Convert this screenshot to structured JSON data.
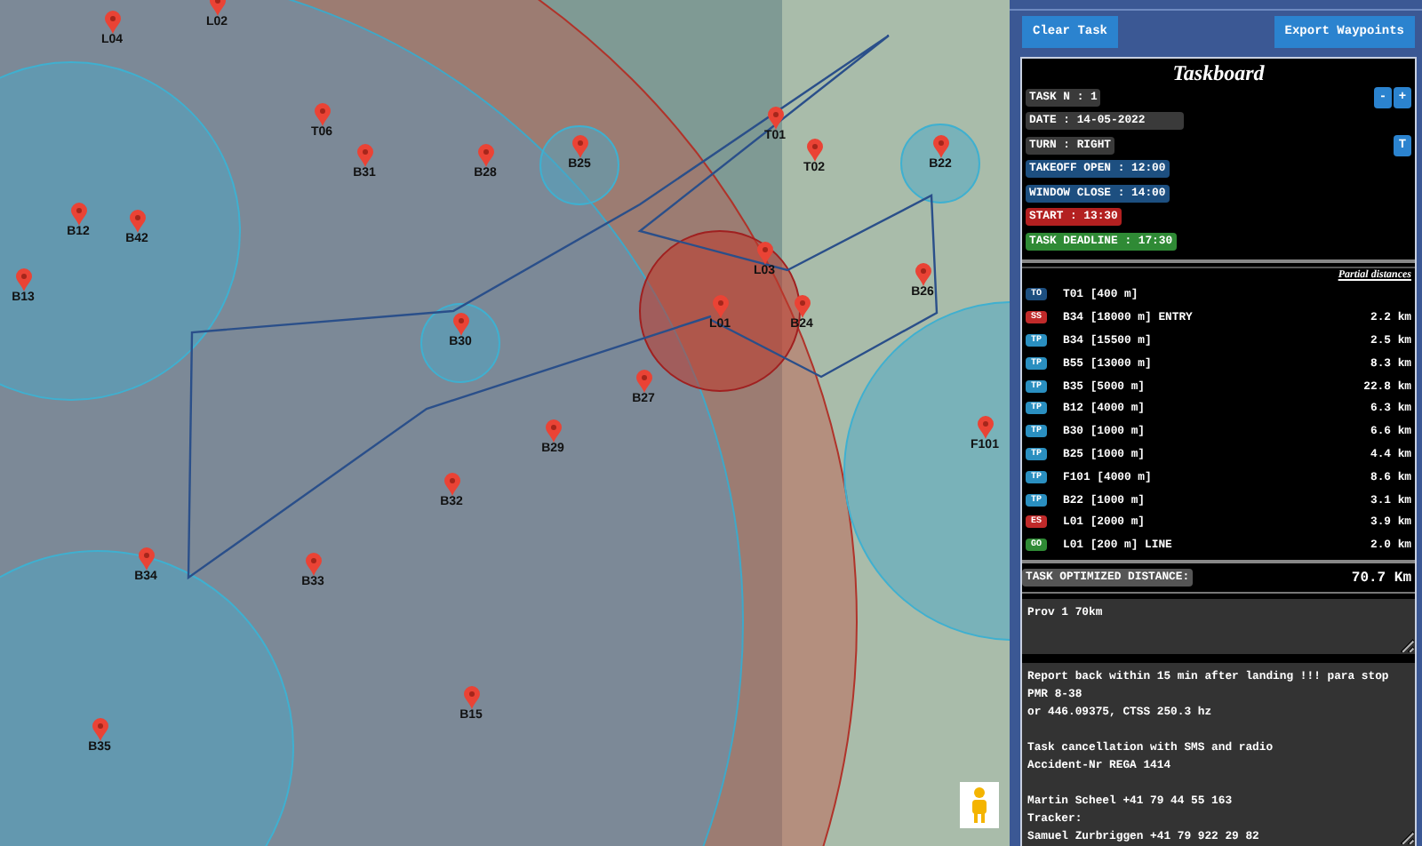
{
  "map": {
    "markers": [
      {
        "label": "L04"
      },
      {
        "label": "L02"
      },
      {
        "label": "T06"
      },
      {
        "label": "B31"
      },
      {
        "label": "B28"
      },
      {
        "label": "B12"
      },
      {
        "label": "B42"
      },
      {
        "label": "B13"
      },
      {
        "label": "B30"
      },
      {
        "label": "B25"
      },
      {
        "label": "T01"
      },
      {
        "label": "T02"
      },
      {
        "label": "B22"
      },
      {
        "label": "L03"
      },
      {
        "label": "L01"
      },
      {
        "label": "B24"
      },
      {
        "label": "B26"
      },
      {
        "label": "B27"
      },
      {
        "label": "B29"
      },
      {
        "label": "F101"
      },
      {
        "label": "B32"
      },
      {
        "label": "B34"
      },
      {
        "label": "B33"
      },
      {
        "label": "B35"
      },
      {
        "label": "B15"
      }
    ]
  },
  "header_buttons": [
    {
      "label": "Clear Task"
    },
    {
      "label": "Export Waypoints"
    }
  ],
  "taskboard": {
    "title": "Taskboard",
    "info": [
      {
        "kind": "neutral",
        "text": "TASK N : 1",
        "buttons": [
          "-",
          "+"
        ]
      },
      {
        "kind": "neutral",
        "text": "DATE : 14-05-2022",
        "wide": true
      },
      {
        "kind": "neutral",
        "text": "TURN : RIGHT",
        "buttons": [
          "T"
        ]
      },
      {
        "kind": "blue",
        "text": "TAKEOFF OPEN : 12:00"
      },
      {
        "kind": "blue",
        "text": "WINDOW CLOSE : 14:00"
      },
      {
        "kind": "red",
        "text": "START : 13:30"
      },
      {
        "kind": "green",
        "text": "TASK DEADLINE : 17:30"
      }
    ],
    "partial_distances_label": "Partial distances",
    "turnpoints": [
      {
        "kind": "TO",
        "badge": "TO",
        "name": "T01 [400 m]"
      },
      {
        "kind": "SS",
        "badge": "SS",
        "name": "B34 [18000 m] ENTRY",
        "distance": "2.2 km"
      },
      {
        "kind": "TP",
        "badge": "TP",
        "name": "B34 [15500 m]",
        "distance": "2.5 km"
      },
      {
        "kind": "TP",
        "badge": "TP",
        "name": "B55 [13000 m]",
        "distance": "8.3 km"
      },
      {
        "kind": "TP",
        "badge": "TP",
        "name": "B35 [5000 m]",
        "distance": "22.8 km"
      },
      {
        "kind": "TP",
        "badge": "TP",
        "name": "B12 [4000 m]",
        "distance": "6.3 km"
      },
      {
        "kind": "TP",
        "badge": "TP",
        "name": "B30 [1000 m]",
        "distance": "6.6 km"
      },
      {
        "kind": "TP",
        "badge": "TP",
        "name": "B25 [1000 m]",
        "distance": "4.4 km"
      },
      {
        "kind": "TP",
        "badge": "TP",
        "name": "F101 [4000 m]",
        "distance": "8.6 km"
      },
      {
        "kind": "TP",
        "badge": "TP",
        "name": "B22 [1000 m]",
        "distance": "3.1 km"
      },
      {
        "kind": "ES",
        "badge": "ES",
        "name": "L01 [2000 m]",
        "distance": "3.9 km"
      },
      {
        "kind": "GO",
        "badge": "GO",
        "name": "L01 [200 m] LINE",
        "distance": "2.0 km"
      }
    ],
    "optimized_distance": {
      "label": "TASK OPTIMIZED DISTANCE:",
      "value": "70.7 Km"
    },
    "title_field": "Prov 1 70km",
    "info_field": "Report back within 15 min after landing !!! para stop\nPMR 8-38\nor 446.09375, CTSS 250.3 hz\n\nTask cancellation with SMS and radio\nAccident-Nr REGA 1414\n\nMartin Scheel +41 79 44 55 163\nTracker:\nSamuel Zurbriggen +41 79 922 29 82"
  }
}
